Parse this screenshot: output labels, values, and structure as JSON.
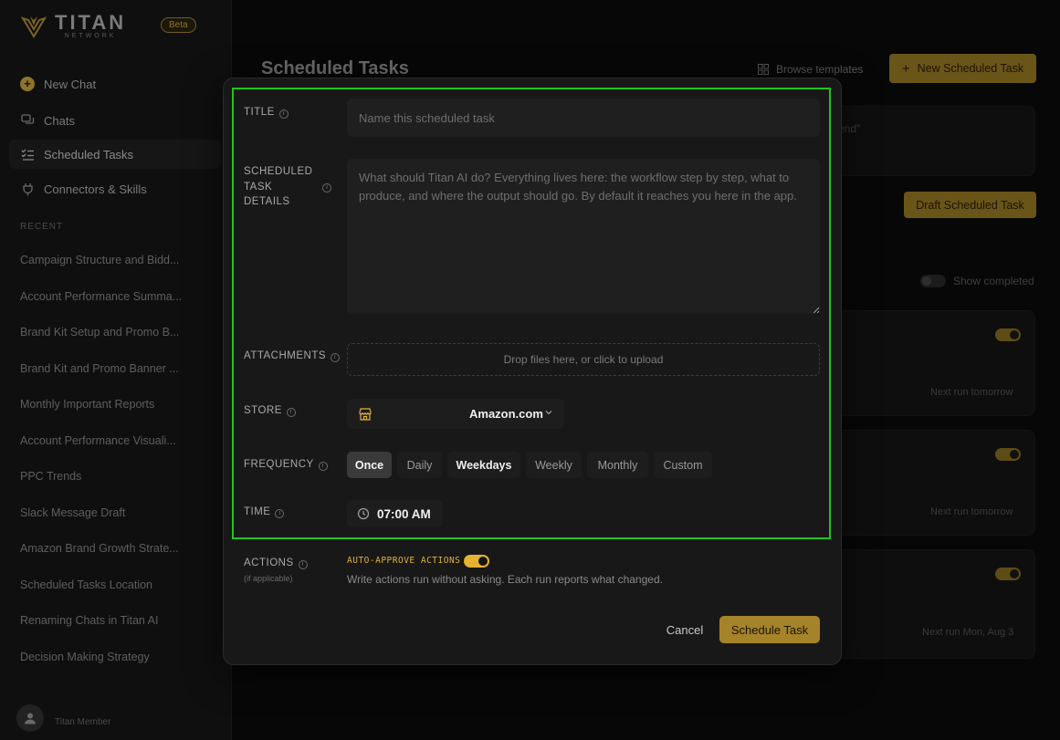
{
  "brand": {
    "name": "TITAN",
    "sub": "NETWORK",
    "badge": "Beta"
  },
  "sidebar": {
    "nav": [
      {
        "label": "New Chat",
        "icon": "plus-circle-icon"
      },
      {
        "label": "Chats",
        "icon": "chat-icon"
      },
      {
        "label": "Scheduled Tasks",
        "icon": "checklist-icon",
        "active": true
      },
      {
        "label": "Connectors & Skills",
        "icon": "plug-icon"
      }
    ],
    "recent_label": "RECENT",
    "recent": [
      "Campaign Structure and Bidd...",
      "Account Performance Summa...",
      "Brand Kit Setup and Promo B...",
      "Brand Kit and Promo Banner ...",
      "Monthly Important Reports",
      "Account Performance Visuali...",
      "PPC Trends",
      "Slack Message Draft",
      "Amazon Brand Growth Strate...",
      "Scheduled Tasks Location",
      "Renaming Chats in Titan AI",
      "Decision Making Strategy"
    ],
    "user": "Titan Member"
  },
  "main": {
    "title": "Scheduled Tasks",
    "browse_label": "Browse templates",
    "new_task_label": "New Scheduled Task",
    "draft_label": "Draft Scheduled Task",
    "show_completed": "Show completed",
    "partial_text": "end\"",
    "next_runs": [
      "Next run tomorrow",
      "Next run tomorrow",
      "Next run Mon, Aug 3"
    ]
  },
  "modal": {
    "title_label": "TITLE",
    "title_placeholder": "Name this scheduled task",
    "details_label": "SCHEDULED TASK DETAILS",
    "details_placeholder": "What should Titan AI do? Everything lives here: the workflow step by step, what to produce, and where the output should go. By default it reaches you here in the app.",
    "attachments_label": "ATTACHMENTS",
    "dropzone_text": "Drop files here, or click to upload",
    "store_label": "STORE",
    "store_value": "Amazon.com",
    "frequency_label": "FREQUENCY",
    "frequency_options": [
      "Once",
      "Daily",
      "Weekdays",
      "Weekly",
      "Monthly",
      "Custom"
    ],
    "frequency_selected": "Once",
    "time_label": "TIME",
    "time_value": "07:00 AM",
    "actions_label": "ACTIONS",
    "actions_sub": "(if applicable)",
    "auto_approve_label": "AUTO-APPROVE ACTIONS",
    "auto_approve_on": true,
    "auto_approve_desc": "Write actions run without asking. Each run reports what changed.",
    "cancel_label": "Cancel",
    "submit_label": "Schedule Task"
  },
  "colors": {
    "accent": "#a58329",
    "toggle": "#e6b330",
    "highlight": "#22c41c"
  }
}
